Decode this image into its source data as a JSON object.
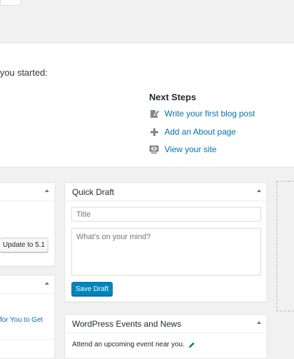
{
  "welcome": {
    "subtitle": "you started:",
    "next_steps": {
      "title": "Next Steps",
      "items": [
        {
          "label": "Write your first blog post",
          "icon": "edit-page-icon"
        },
        {
          "label": "Add an About page",
          "icon": "plus-icon"
        },
        {
          "label": "View your site",
          "icon": "view-site-icon"
        }
      ]
    }
  },
  "left_column": {
    "update_button": "Update to 5.1",
    "link_text": "for You to Get"
  },
  "quick_draft": {
    "title": "Quick Draft",
    "title_placeholder": "Title",
    "content_placeholder": "What’s on your mind?",
    "save_label": "Save Draft"
  },
  "events": {
    "title": "WordPress Events and News",
    "text": "Attend an upcoming event near you."
  },
  "colors": {
    "link": "#0073aa",
    "primary_button": "#0085ba",
    "background": "#f1f1f1"
  }
}
